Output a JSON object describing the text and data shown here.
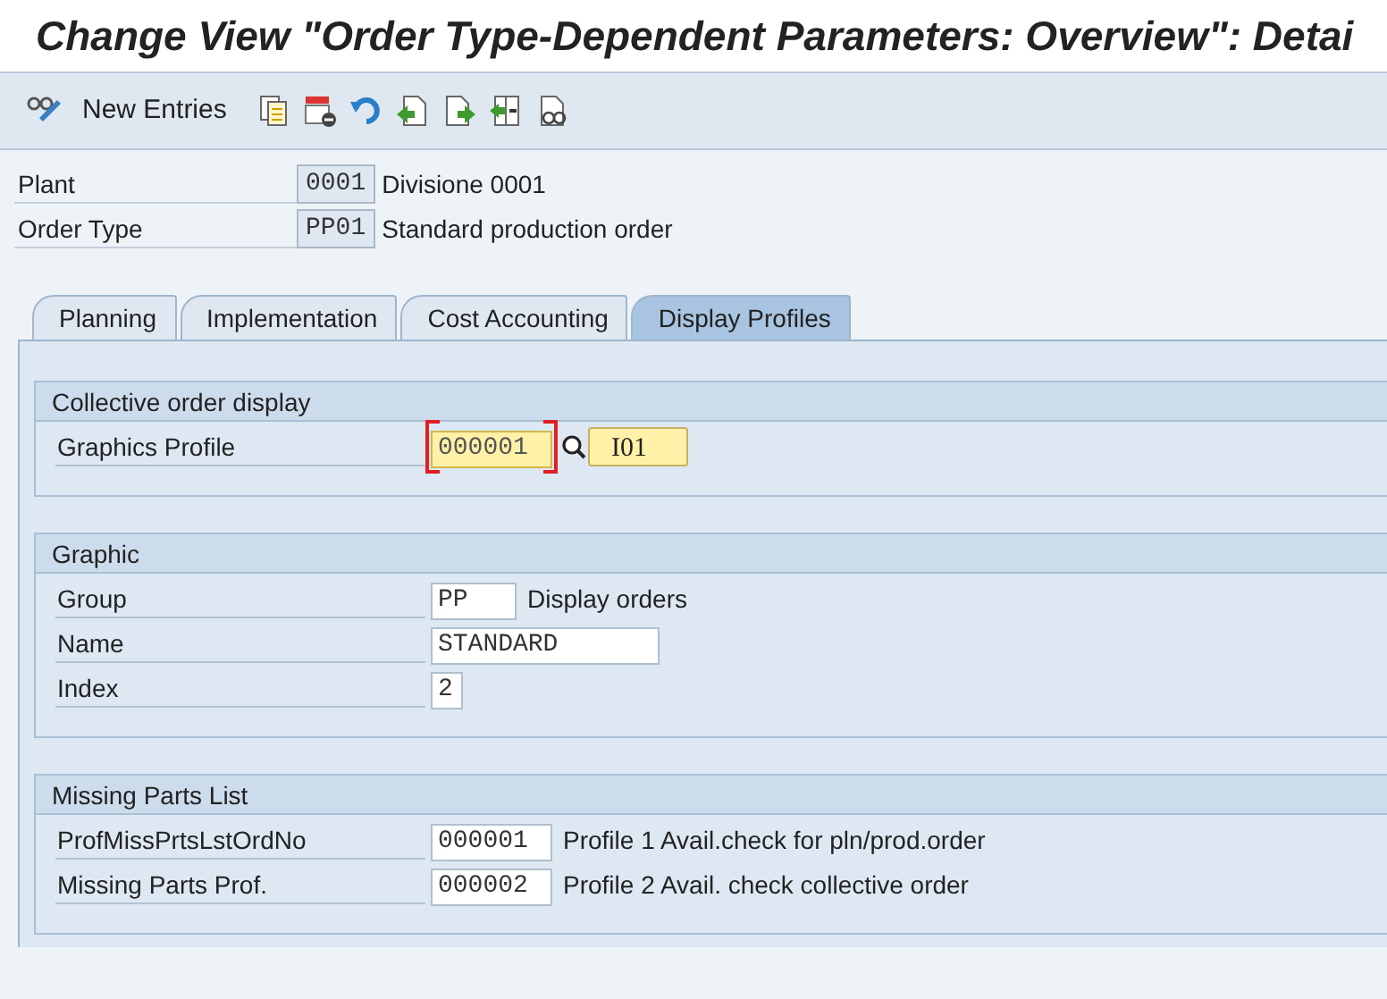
{
  "window": {
    "title": "Change View \"Order Type-Dependent Parameters: Overview\": Detai"
  },
  "toolbar": {
    "new_entries": "New Entries"
  },
  "header_fields": [
    {
      "label": "Plant",
      "value": "0001",
      "description": "Divisione 0001"
    },
    {
      "label": "Order Type",
      "value": "PP01",
      "description": "Standard production order"
    }
  ],
  "tabs": [
    {
      "label": "Planning",
      "selected": false
    },
    {
      "label": "Implementation",
      "selected": false
    },
    {
      "label": "Cost Accounting",
      "selected": false
    },
    {
      "label": "Display Profiles",
      "selected": true
    }
  ],
  "groups": [
    {
      "title": "Collective order display",
      "fields": [
        {
          "label": "Graphics Profile",
          "value": "000001",
          "focused": true,
          "button": "I01"
        }
      ]
    },
    {
      "title": "Graphic",
      "fields": [
        {
          "label": "Group",
          "value": "PP",
          "focused": false,
          "description": "Display orders"
        },
        {
          "label": "Name",
          "value": "STANDARD",
          "focused": false
        },
        {
          "label": "Index",
          "value": "2",
          "focused": false
        }
      ]
    },
    {
      "title": "Missing Parts List",
      "fields": [
        {
          "label": "ProfMissPrtsLstOrdNo",
          "value": "000001",
          "focused": false,
          "description": "Profile 1 Avail.check for pln/prod.order"
        },
        {
          "label": "Missing Parts Prof.",
          "value": "000002",
          "focused": false,
          "description": "Profile 2 Avail. check collective order"
        }
      ]
    }
  ]
}
